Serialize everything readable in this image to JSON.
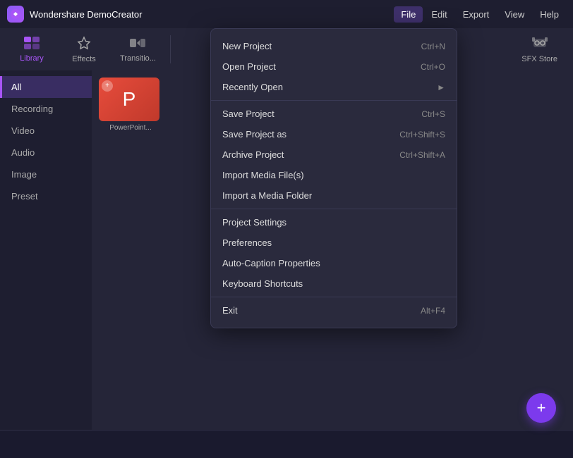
{
  "app": {
    "logo": "W",
    "title": "Wondershare DemoCreator"
  },
  "menu_bar": {
    "items": [
      {
        "id": "file",
        "label": "File",
        "active": true
      },
      {
        "id": "edit",
        "label": "Edit",
        "active": false
      },
      {
        "id": "export",
        "label": "Export",
        "active": false
      },
      {
        "id": "view",
        "label": "View",
        "active": false
      },
      {
        "id": "help",
        "label": "Help",
        "active": false
      }
    ]
  },
  "toolbar": {
    "items": [
      {
        "id": "library",
        "label": "Library",
        "icon": "☰",
        "active": true
      },
      {
        "id": "effects",
        "label": "Effects",
        "icon": "✦",
        "active": false
      },
      {
        "id": "transitions",
        "label": "Transitio...",
        "icon": "⏭",
        "active": false
      }
    ],
    "sfx_store": {
      "label": "SFX Store",
      "icon": "🎧"
    }
  },
  "sidebar": {
    "items": [
      {
        "id": "all",
        "label": "All",
        "active": true
      },
      {
        "id": "recording",
        "label": "Recording",
        "active": false
      },
      {
        "id": "video",
        "label": "Video",
        "active": false
      },
      {
        "id": "audio",
        "label": "Audio",
        "active": false
      },
      {
        "id": "image",
        "label": "Image",
        "active": false
      },
      {
        "id": "preset",
        "label": "Preset",
        "active": false
      }
    ]
  },
  "content": {
    "items": [
      {
        "id": "powerpoint",
        "label": "PowerPoint..."
      }
    ]
  },
  "fab": {
    "icon": "+"
  },
  "dropdown": {
    "sections": [
      {
        "id": "new-open",
        "items": [
          {
            "id": "new-project",
            "label": "New Project",
            "shortcut": "Ctrl+N",
            "has_arrow": false
          },
          {
            "id": "open-project",
            "label": "Open Project",
            "shortcut": "Ctrl+O",
            "has_arrow": false
          },
          {
            "id": "recently-open",
            "label": "Recently Open",
            "shortcut": "",
            "has_arrow": true
          }
        ]
      },
      {
        "id": "save",
        "items": [
          {
            "id": "save-project",
            "label": "Save Project",
            "shortcut": "Ctrl+S",
            "has_arrow": false
          },
          {
            "id": "save-project-as",
            "label": "Save Project as",
            "shortcut": "Ctrl+Shift+S",
            "has_arrow": false
          },
          {
            "id": "archive-project",
            "label": "Archive Project",
            "shortcut": "Ctrl+Shift+A",
            "has_arrow": false
          },
          {
            "id": "import-media",
            "label": "Import Media File(s)",
            "shortcut": "",
            "has_arrow": false
          },
          {
            "id": "import-folder",
            "label": "Import a Media Folder",
            "shortcut": "",
            "has_arrow": false
          }
        ]
      },
      {
        "id": "settings",
        "items": [
          {
            "id": "project-settings",
            "label": "Project Settings",
            "shortcut": "",
            "has_arrow": false
          },
          {
            "id": "preferences",
            "label": "Preferences",
            "shortcut": "",
            "has_arrow": false
          },
          {
            "id": "auto-caption",
            "label": "Auto-Caption Properties",
            "shortcut": "",
            "has_arrow": false
          },
          {
            "id": "keyboard-shortcuts",
            "label": "Keyboard Shortcuts",
            "shortcut": "",
            "has_arrow": false
          }
        ]
      },
      {
        "id": "exit",
        "items": [
          {
            "id": "exit",
            "label": "Exit",
            "shortcut": "Alt+F4",
            "has_arrow": false
          }
        ]
      }
    ]
  }
}
